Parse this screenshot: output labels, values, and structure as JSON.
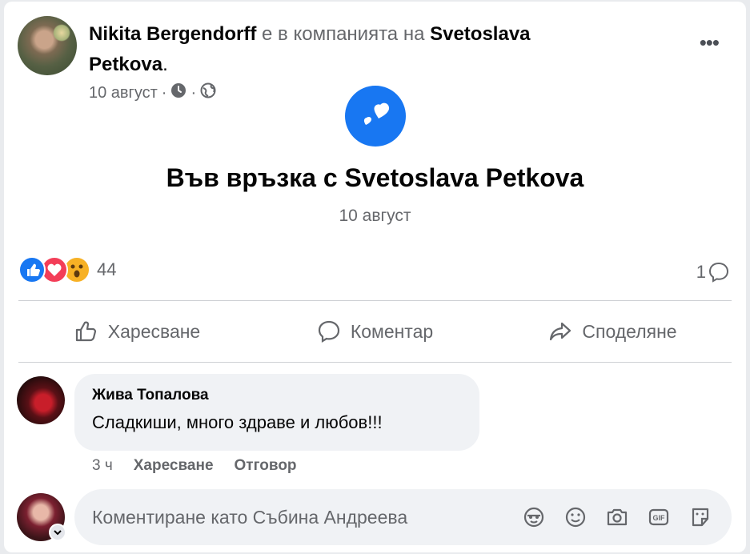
{
  "post": {
    "author": "Nikita Bergendorff",
    "with_text": " е в компанията на ",
    "tagged_line1": "Svetoslava",
    "tagged_line2": "Petkova",
    "tagged_suffix": ".",
    "date": "10 август",
    "sep1": "·",
    "sep2": "·"
  },
  "life_event": {
    "title": "Във връзка с Svetoslava Petkova",
    "date": "10 август"
  },
  "stats": {
    "reactions_count": "44",
    "comments_count": "1"
  },
  "actions": {
    "like": "Харесване",
    "comment": "Коментар",
    "share": "Споделяне"
  },
  "comment": {
    "author": "Жива Топалова",
    "text": "Сладкиши, много здраве и любов!!!",
    "time": "3 ч",
    "like": "Харесване",
    "reply": "Отговор"
  },
  "composer": {
    "placeholder": "Коментиране като Събина Андреева"
  },
  "colors": {
    "accent": "#1877f2",
    "love": "#f33e58",
    "wow": "#f7b125"
  },
  "icons": {
    "privacy": "clock-icon",
    "audience": "globe-icon",
    "event": "hearts-icon",
    "composer_tools": [
      "avatar-sticker-icon",
      "emoji-icon",
      "camera-icon",
      "gif-icon",
      "sticker-icon"
    ]
  }
}
